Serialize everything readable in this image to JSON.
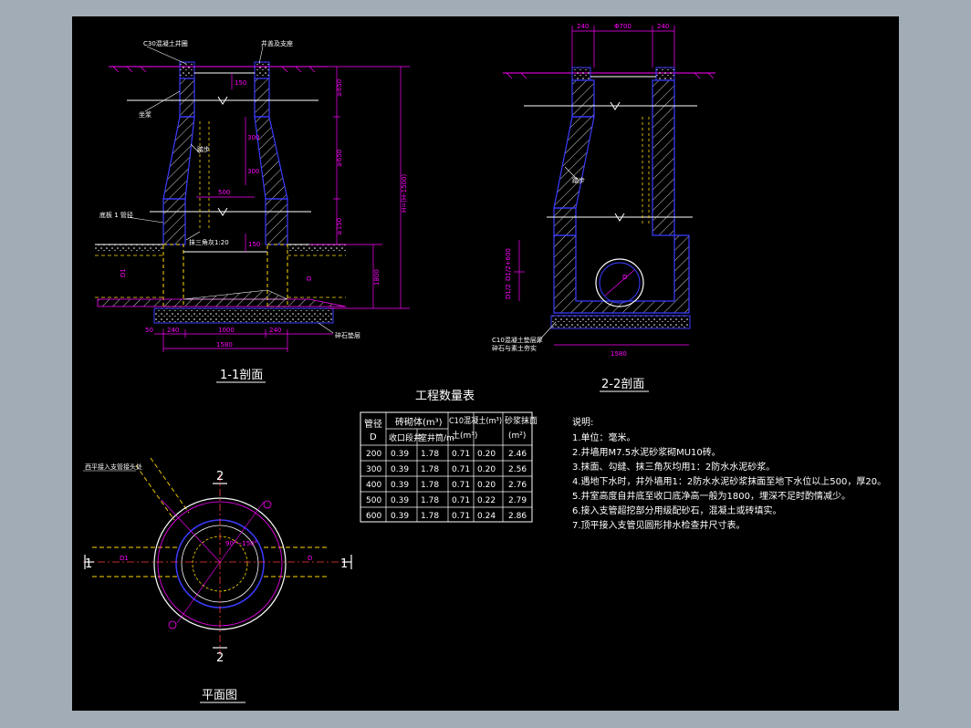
{
  "captions": {
    "section11": "1-1剖面",
    "section22": "2-2剖面",
    "plan": "平面图",
    "table_title": "工程数量表"
  },
  "labels11": {
    "top1": "C30混凝土井圈",
    "top2": "井盖及支座",
    "ladder": "踏步",
    "cushion": "坐浆",
    "dia300": "300",
    "dim500": "500",
    "side_left": "底板 1 管径",
    "step_note": "抹三角灰1:20",
    "bottom_right": "碎石垫层",
    "dim_1800": "1800",
    "dim_h": "H=(H-1500)",
    "dim_a": "≥650",
    "dim_b": "≥650",
    "dim_c": "≥150",
    "bot_240a": "240",
    "bot_1000": "1000",
    "bot_240b": "240",
    "bot_1580": "1580",
    "bot_50": "50",
    "d_label": "D",
    "d1_label": "D1",
    "d150": "150",
    "d300b": "300",
    "d150b": "150"
  },
  "labels22": {
    "top_240a": "240",
    "top_700": "Φ700",
    "top_240b": "240",
    "ladder": "踏步",
    "bottom_note1": "C10混凝土垫层厚",
    "bottom_note2": "碎石与素土夯实",
    "dim_1580": "1580",
    "dim_d": "D1/2+600",
    "dim_d2": "D1/2",
    "circle_d": "D"
  },
  "plan": {
    "label_pipe": "西平接入支管接头处",
    "angle": "90°~150°",
    "label_d": "D",
    "label_d1": "D1",
    "mark1l": "1",
    "mark1r": "1",
    "mark2t": "2",
    "mark2b": "2"
  },
  "table": {
    "h_pipe": "管径",
    "h_d": "D",
    "h_brick": "砖砌体(m³)",
    "h_shrink": "收口段井",
    "h_chamber": "室井筒/m",
    "h_concrete": "C10混凝土(m³)",
    "h_concrete_unit": "土(m³)",
    "h_mortar": "砂浆抹面",
    "h_mortar_unit": "(m²)",
    "rows": [
      [
        "200",
        "0.39",
        "1.78",
        "0.71",
        "0.20",
        "2.46"
      ],
      [
        "300",
        "0.39",
        "1.78",
        "0.71",
        "0.20",
        "2.56"
      ],
      [
        "400",
        "0.39",
        "1.78",
        "0.71",
        "0.20",
        "2.76"
      ],
      [
        "500",
        "0.39",
        "1.78",
        "0.71",
        "0.22",
        "2.79"
      ],
      [
        "600",
        "0.39",
        "1.78",
        "0.71",
        "0.24",
        "2.86"
      ]
    ]
  },
  "notes": {
    "title": "说明:",
    "lines": [
      "1.单位：毫米。",
      "2.井墙用M7.5水泥砂浆砌MU10砖。",
      "3.抹面、勾缝、抹三角灰均用1：2防水水泥砂浆。",
      "4.遇地下水时，井外墙用1：2防水水泥砂浆抹面至地下水位以上500，厚20。",
      "5.井室高度自井底至收口底净高一般为1800，埋深不足时酌情减少。",
      "6.接入支管超挖部分用级配砂石，混凝土或砖填实。",
      "7.顶平接入支管见圆形排水检查井尺寸表。"
    ]
  },
  "colors": {
    "background": "#000000",
    "frame": "#a2acb6",
    "wall": "#3b3bff",
    "dim": "#ff00ff",
    "line": "#ffffff",
    "center": "#ff3b3b",
    "pipe": "#ffd700",
    "hatch": "#ffffff"
  }
}
